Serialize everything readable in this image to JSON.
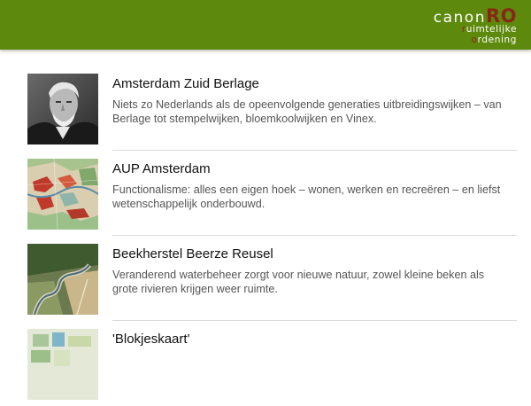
{
  "header": {
    "logo_canon": "canon",
    "logo_ro": "RO",
    "logo_line1_first": "r",
    "logo_line1_rest": "uimtelijke",
    "logo_line2_first": "o",
    "logo_line2_rest": "rdening",
    "background": "#5d890c"
  },
  "items": [
    {
      "title": "Amsterdam Zuid Berlage",
      "description": "Niets zo Nederlands als de opeenvolgende generaties uitbreidingswijken – van Berlage tot stempelwijken, bloemkoolwijken en Vinex.",
      "image": "portrait-photo"
    },
    {
      "title": "AUP Amsterdam",
      "description": "Functionalisme: alles een eigen hoek – wonen, werken en recreëren – en liefst wetenschappelijk onderbouwd.",
      "image": "plan-map"
    },
    {
      "title": "Beekherstel Beerze Reusel",
      "description": "Veranderend waterbeheer zorgt voor nieuwe natuur, zowel kleine beken als grote rivieren krijgen weer ruimte.",
      "image": "aerial-photo"
    },
    {
      "title": "'Blokjeskaart'",
      "description": "",
      "image": "map-thumbnail"
    }
  ]
}
